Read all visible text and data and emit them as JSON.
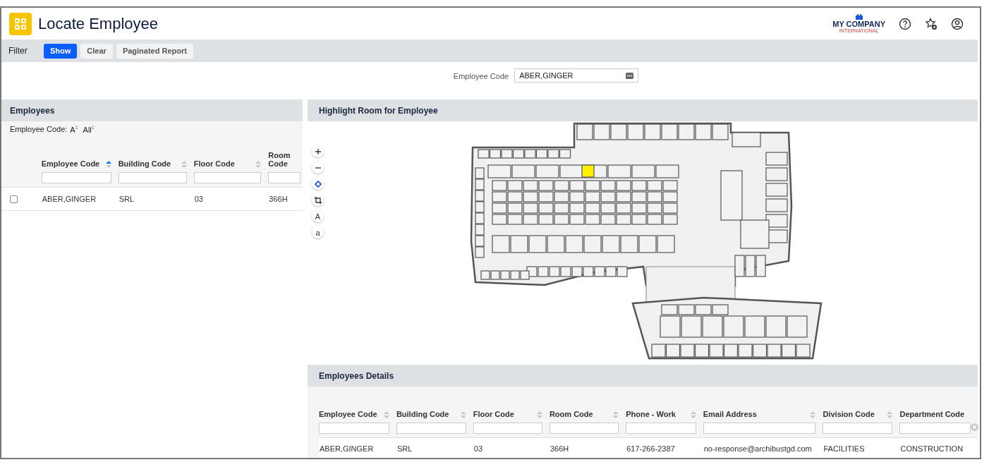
{
  "header": {
    "title": "Locate Employee",
    "logo": {
      "name": "MY COMPANY",
      "tagline": "INTERNATIONAL"
    },
    "actions": [
      {
        "kind": "help"
      },
      {
        "kind": "favorite-add"
      },
      {
        "kind": "user"
      }
    ]
  },
  "filter_bar": {
    "label": "Filter",
    "buttons": [
      {
        "label": "Show",
        "primary": true
      },
      {
        "label": "Clear",
        "primary": false
      },
      {
        "label": "Paginated Report",
        "primary": false
      }
    ]
  },
  "filter_fields": [
    {
      "label": "Employee Code",
      "value": "ABER,GINGER"
    }
  ],
  "employees_panel": {
    "title": "Employees",
    "index": {
      "label": "Employee Code:",
      "links": [
        {
          "label": "A",
          "count": "1"
        },
        {
          "label": "All",
          "count": "1"
        }
      ]
    },
    "columns": [
      {
        "label": "Employee Code",
        "sort_ascending": true
      },
      {
        "label": "Building Code",
        "sort_ascending": false
      },
      {
        "label": "Floor Code",
        "sort_ascending": false
      },
      {
        "label": "Room Code"
      }
    ],
    "rows": [
      {
        "checked": false,
        "cells": [
          "ABER,GINGER",
          "SRL",
          "03",
          "366H"
        ]
      }
    ]
  },
  "map_panel": {
    "title": "Highlight Room for Employee",
    "tools": [
      {
        "kind": "zoom-in"
      },
      {
        "kind": "zoom-out"
      },
      {
        "kind": "locate"
      },
      {
        "kind": "select"
      },
      {
        "kind": "label",
        "label": "A"
      },
      {
        "kind": "label",
        "label": "a"
      }
    ]
  },
  "details_panel": {
    "title": "Employees Details",
    "columns": [
      {
        "label": "Employee Code",
        "sort_ascending": false
      },
      {
        "label": "Building Code",
        "sort_ascending": false
      },
      {
        "label": "Floor Code",
        "sort_ascending": false
      },
      {
        "label": "Room Code",
        "sort_ascending": false
      },
      {
        "label": "Phone - Work",
        "sort_ascending": false
      },
      {
        "label": "Email Address",
        "sort_ascending": false,
        "wide": true
      },
      {
        "label": "Division Code",
        "sort_ascending": false
      },
      {
        "label": "Department Code"
      }
    ],
    "rows": [
      {
        "cells": [
          "ABER,GINGER",
          "SRL",
          "03",
          "366H",
          "617-266-2387",
          "no-response@archibustgd.com",
          "FACILITIES",
          "CONSTRUCTION"
        ]
      }
    ]
  }
}
